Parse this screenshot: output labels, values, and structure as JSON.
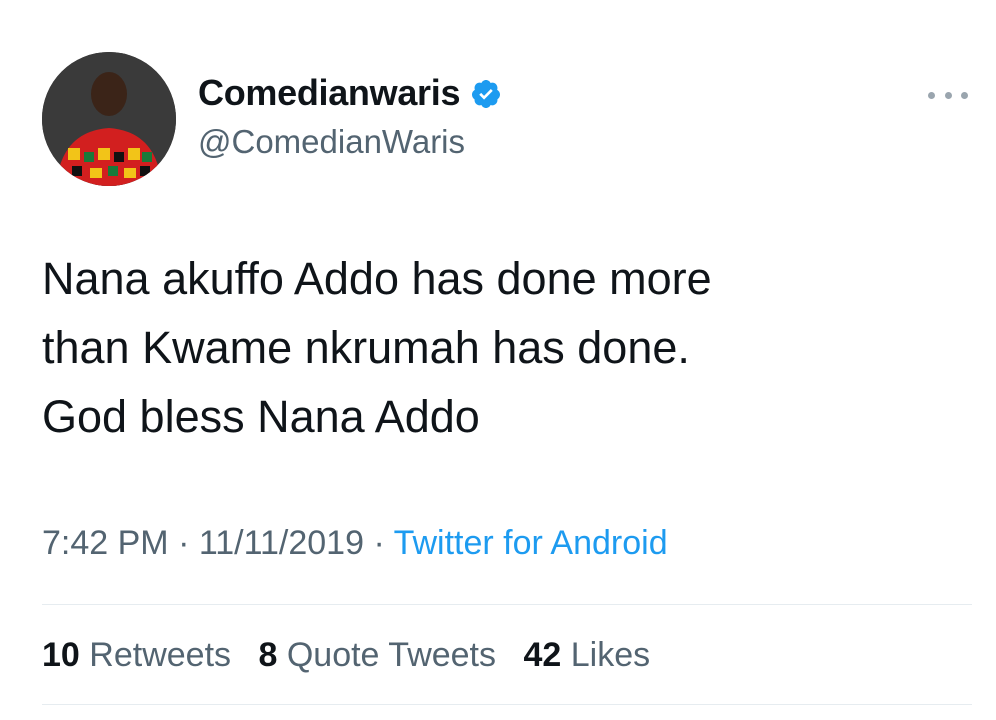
{
  "tweet": {
    "author": {
      "display_name": "Comedianwaris",
      "handle": "@ComedianWaris",
      "verified": true,
      "avatar_icon": "user-avatar"
    },
    "text_lines": [
      "Nana akuffo Addo has done more",
      "than Kwame nkrumah has done.",
      "God bless Nana Addo"
    ],
    "time": "7:42 PM",
    "separator": "·",
    "date": "11/11/2019",
    "source": "Twitter for Android",
    "stats": {
      "retweets": {
        "count": "10",
        "label": "Retweets"
      },
      "quote_tweets": {
        "count": "8",
        "label": "Quote Tweets"
      },
      "likes": {
        "count": "42",
        "label": "Likes"
      }
    }
  },
  "colors": {
    "text_primary": "#0f1419",
    "text_secondary": "#536471",
    "link": "#1d9bf0",
    "verified_badge": "#1d9bf0",
    "divider": "#e6ecf0"
  }
}
